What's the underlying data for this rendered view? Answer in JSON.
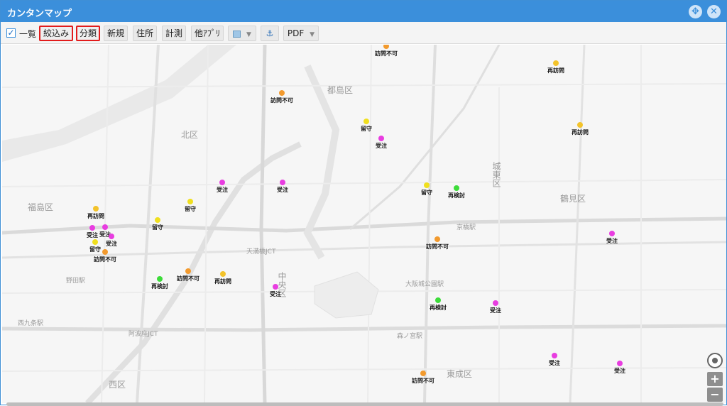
{
  "window": {
    "title": "カンタンマップ"
  },
  "toolbar": {
    "list_label": "一覧",
    "buttons": [
      "絞込み",
      "分類",
      "新規",
      "住所",
      "計測",
      "他ｱﾌﾟﾘ",
      "PDF"
    ],
    "layer_icon": "map-layer-icon",
    "anchor_icon": "anchor-icon"
  },
  "colors": {
    "title_bar": "#3b8fdb",
    "highlight_border": "#e21b1b",
    "status": {
      "受注": "#e83de0",
      "留守": "#f0df1e",
      "再訪問": "#f3c32b",
      "訪問不可": "#f29a2e",
      "再検討": "#3ddc3a"
    }
  },
  "map_labels": [
    "北区",
    "都島区",
    "城東区",
    "鶴見区",
    "福島区",
    "中央区",
    "東成区",
    "西区",
    "天満橋JCT",
    "阿波座JCT",
    "西九条駅",
    "森ノ宮駅",
    "野田駅",
    "大阪城公園駅",
    "京橋駅"
  ],
  "pins": [
    {
      "status": "訪問不可",
      "label": "訪問不可"
    },
    {
      "status": "再訪問",
      "label": "再訪問"
    },
    {
      "status": "訪問不可",
      "label": "訪問不可"
    },
    {
      "status": "留守",
      "label": "留守"
    },
    {
      "status": "受注",
      "label": "受注"
    },
    {
      "status": "再訪問",
      "label": "再訪問"
    },
    {
      "status": "受注",
      "label": "受注"
    },
    {
      "status": "受注",
      "label": "受注"
    },
    {
      "status": "留守",
      "label": "留守"
    },
    {
      "status": "再検討",
      "label": "再検討"
    },
    {
      "status": "留守",
      "label": "留守"
    },
    {
      "status": "再訪問",
      "label": "再訪問"
    },
    {
      "status": "留守",
      "label": "留守"
    },
    {
      "status": "受注",
      "label": "受注"
    },
    {
      "status": "受注",
      "label": "受注"
    },
    {
      "status": "受注",
      "label": "受注"
    },
    {
      "status": "留守",
      "label": "留守"
    },
    {
      "status": "訪問不可",
      "label": "訪問不可"
    },
    {
      "status": "受注",
      "label": "受注"
    },
    {
      "status": "訪問不可",
      "label": "訪問不可"
    },
    {
      "status": "再検討",
      "label": "再検討"
    },
    {
      "status": "訪問不可",
      "label": "訪問不可"
    },
    {
      "status": "再訪問",
      "label": "再訪問"
    },
    {
      "status": "受注",
      "label": "受注"
    },
    {
      "status": "再検討",
      "label": "再検討"
    },
    {
      "status": "受注",
      "label": "受注"
    },
    {
      "status": "受注",
      "label": "受注"
    },
    {
      "status": "受注",
      "label": "受注"
    },
    {
      "status": "訪問不可",
      "label": "訪問不可"
    }
  ],
  "zoom": {
    "in": "+",
    "out": "−"
  }
}
